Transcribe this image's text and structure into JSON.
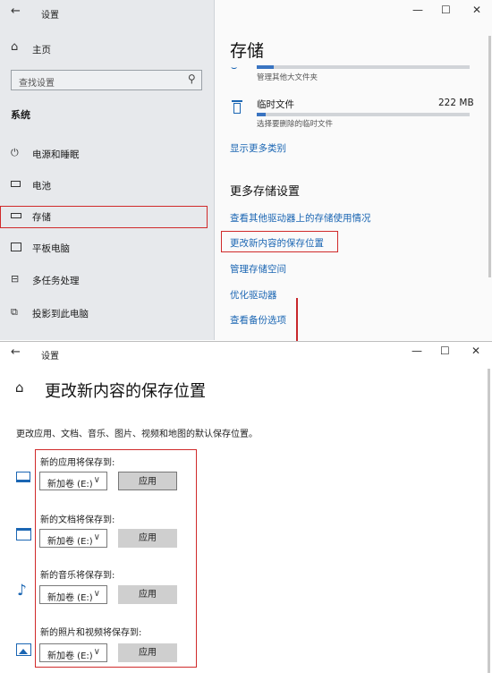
{
  "top_window": {
    "title": "设置",
    "controls": {
      "minimize": "—",
      "maximize": "☐",
      "close": "✕"
    },
    "sidebar": {
      "home": "主页",
      "search_placeholder": "查找设置",
      "section": "系统",
      "items": [
        {
          "label": "电源和睡眠",
          "icon": "power-icon"
        },
        {
          "label": "电池",
          "icon": "battery-icon"
        },
        {
          "label": "存储",
          "icon": "storage-icon"
        },
        {
          "label": "平板电脑",
          "icon": "tablet-icon"
        },
        {
          "label": "多任务处理",
          "icon": "multitask-icon"
        },
        {
          "label": "投影到此电脑",
          "icon": "project-icon"
        }
      ]
    },
    "main": {
      "title": "存储",
      "large_files_desc": "管理其他大文件夹",
      "large_files_fill": 0.08,
      "temp": {
        "name": "临时文件",
        "size": "222 MB",
        "desc": "选择要删除的临时文件",
        "fill": 0.04
      },
      "show_more": "显示更多类别",
      "more_heading": "更多存储设置",
      "links": [
        "查看其他驱动器上的存储使用情况",
        "更改新内容的保存位置",
        "管理存储空间",
        "优化驱动器",
        "查看备份选项"
      ]
    }
  },
  "bottom_window": {
    "title": "设置",
    "controls": {
      "minimize": "—",
      "maximize": "☐",
      "close": "✕"
    },
    "page_title": "更改新内容的保存位置",
    "description": "更改应用、文档、音乐、图片、视频和地图的默认保存位置。",
    "rows": [
      {
        "label": "新的应用将保存到:",
        "drive": "新加卷 (E:)",
        "button": "应用",
        "icon": "monitor-icon"
      },
      {
        "label": "新的文档将保存到:",
        "drive": "新加卷 (E:)",
        "button": "应用",
        "icon": "folder-icon"
      },
      {
        "label": "新的音乐将保存到:",
        "drive": "新加卷 (E:)",
        "button": "应用",
        "icon": "music-note-icon"
      },
      {
        "label": "新的照片和视频将保存到:",
        "drive": "新加卷 (E:)",
        "button": "应用",
        "icon": "picture-icon"
      }
    ]
  },
  "colors": {
    "accent_link": "#1b66b3",
    "highlight_red": "#d02a2a",
    "arrow_red": "#c8262b",
    "bar_fill": "#3a74c1"
  }
}
